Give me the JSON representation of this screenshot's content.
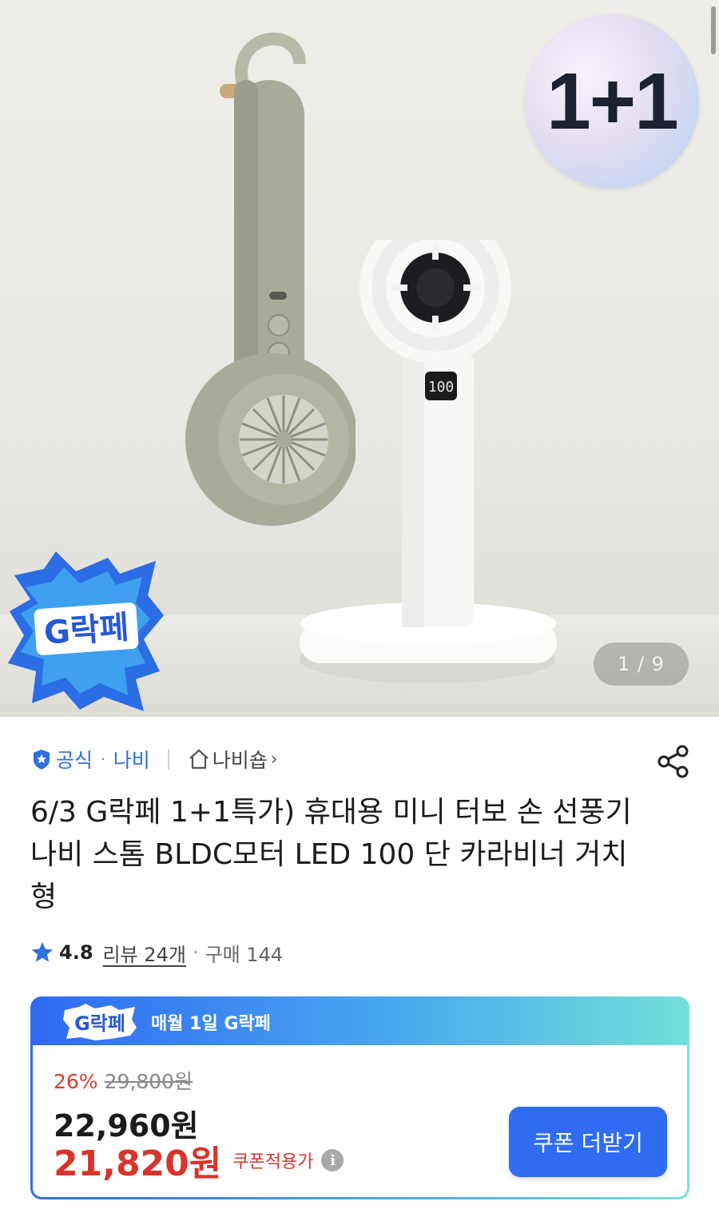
{
  "hero": {
    "promo_badge": "1+1",
    "image_counter": "1 / 9",
    "event_badge": "G락페"
  },
  "store": {
    "official_label": "공식",
    "separator": "·",
    "brand": "나비",
    "shop_link": "나비숍"
  },
  "product": {
    "title": "6/3 G락페 1+1특가) 휴대용 미니 터보 손 선풍기 나비 스톰 BLDC모터 LED 100 단 카라비너 거치형",
    "rating": "4.8",
    "review_link": "리뷰 24개",
    "purchase_count": "구매 144"
  },
  "price_card": {
    "banner_logo": "G락페",
    "banner_text": "매월 1일 G락페",
    "discount_rate": "26%",
    "original_price": "29,800원",
    "sale_price": "22,960원",
    "coupon_price": "21,820원",
    "coupon_price_label": "쿠폰적용가",
    "coupon_button": "쿠폰 더받기"
  },
  "colors": {
    "accent_blue": "#2f6cf2",
    "price_red": "#d8342b",
    "gradient_end": "#74e0d9"
  }
}
